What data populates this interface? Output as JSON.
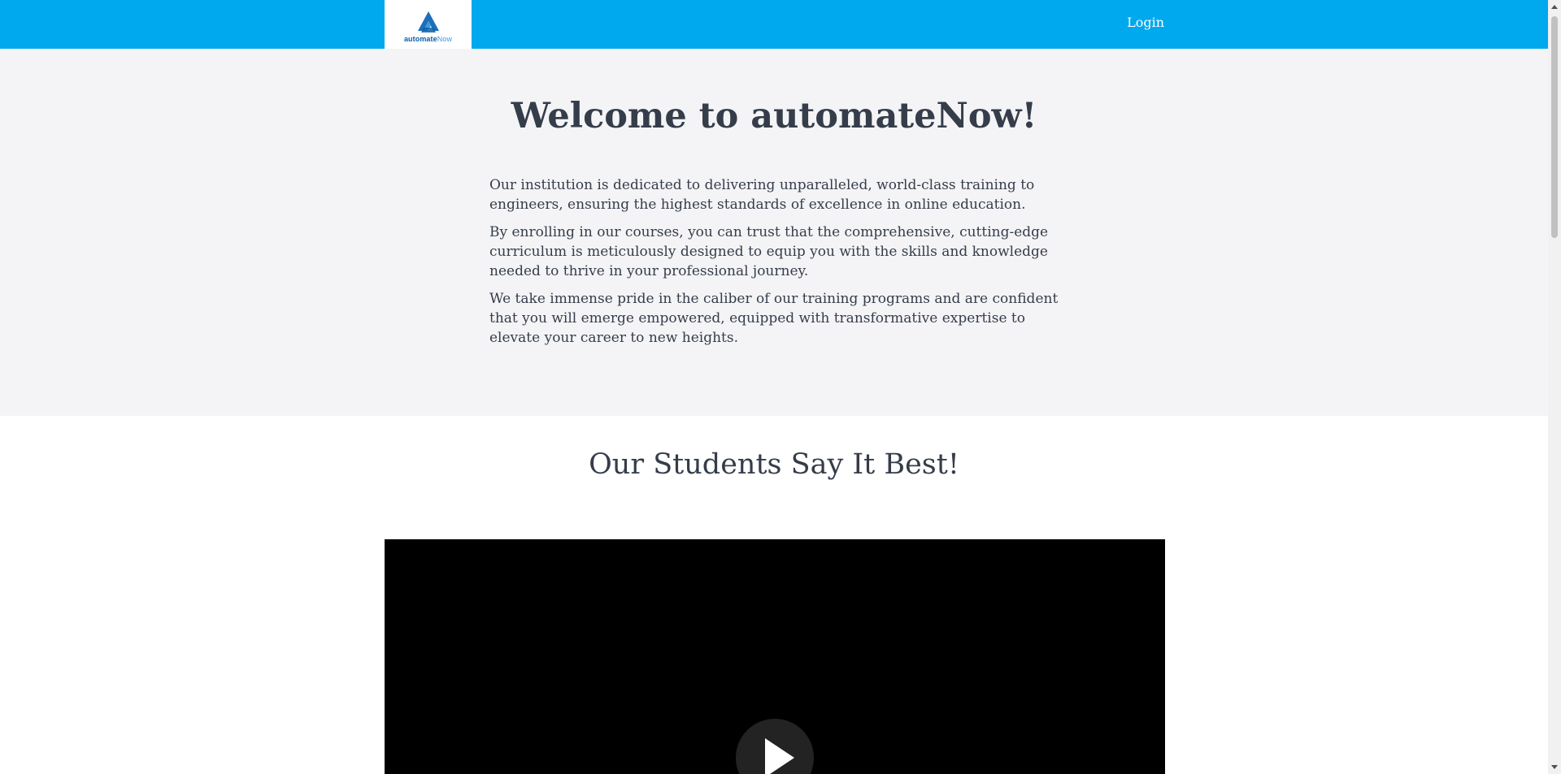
{
  "header": {
    "logo": {
      "text_bold": "automate",
      "text_light": "Now",
      "icon": "automatenow-logo-icon"
    },
    "login_label": "Login"
  },
  "hero": {
    "title": "Welcome to automateNow!",
    "paragraphs": [
      "Our institution is dedicated to delivering unparalleled, world-class training to engineers, ensuring the highest standards of excellence in online education.",
      "By enrolling in our courses, you can trust that the comprehensive, cutting-edge curriculum is meticulously designed to equip you with the skills and knowledge needed to thrive in your professional journey.",
      "We take immense pride in the caliber of our training programs and are confident that you will emerge empowered, equipped with transformative expertise to elevate your career to new heights."
    ]
  },
  "testimonials": {
    "title": "Our Students Say It Best!",
    "video": {
      "play_icon": "play-icon"
    }
  },
  "colors": {
    "header_bg": "#00a8ee",
    "hero_bg": "#f4f4f6",
    "text": "#353d4a"
  }
}
